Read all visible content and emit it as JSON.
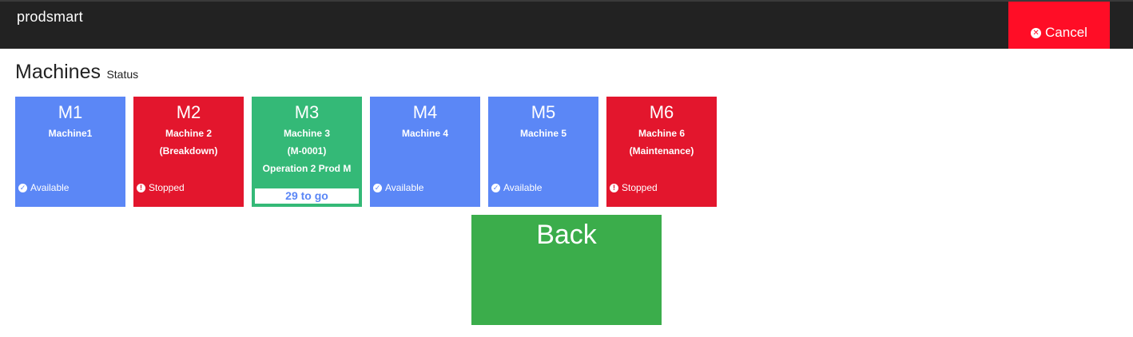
{
  "header": {
    "brand": "prodsmart",
    "cancel_label": "Cancel",
    "cancel_icon": "close-circle-icon"
  },
  "page": {
    "title": "Machines",
    "subtitle": "Status"
  },
  "machines": [
    {
      "code": "M1",
      "lines": [
        "Machine1"
      ],
      "status": "Available",
      "status_icon": "check-circle-icon",
      "color": "#5b87f6"
    },
    {
      "code": "M2",
      "lines": [
        "Machine 2",
        "(Breakdown)"
      ],
      "status": "Stopped",
      "status_icon": "exclamation-circle-icon",
      "color": "#e3162d"
    },
    {
      "code": "M3",
      "lines": [
        "Machine 3",
        "(M-0001)",
        "Operation 2 Prod M"
      ],
      "progress": "29 to go",
      "color": "#34b977"
    },
    {
      "code": "M4",
      "lines": [
        "Machine 4"
      ],
      "status": "Available",
      "status_icon": "check-circle-icon",
      "color": "#5b87f6"
    },
    {
      "code": "M5",
      "lines": [
        "Machine 5"
      ],
      "status": "Available",
      "status_icon": "check-circle-icon",
      "color": "#5b87f6"
    },
    {
      "code": "M6",
      "lines": [
        "Machine 6",
        "(Maintenance)"
      ],
      "status": "Stopped",
      "status_icon": "exclamation-circle-icon",
      "color": "#e3162d"
    }
  ],
  "back_label": "Back",
  "colors": {
    "topbar": "#222222",
    "cancel": "#ff0d26",
    "back": "#3bad4b"
  }
}
